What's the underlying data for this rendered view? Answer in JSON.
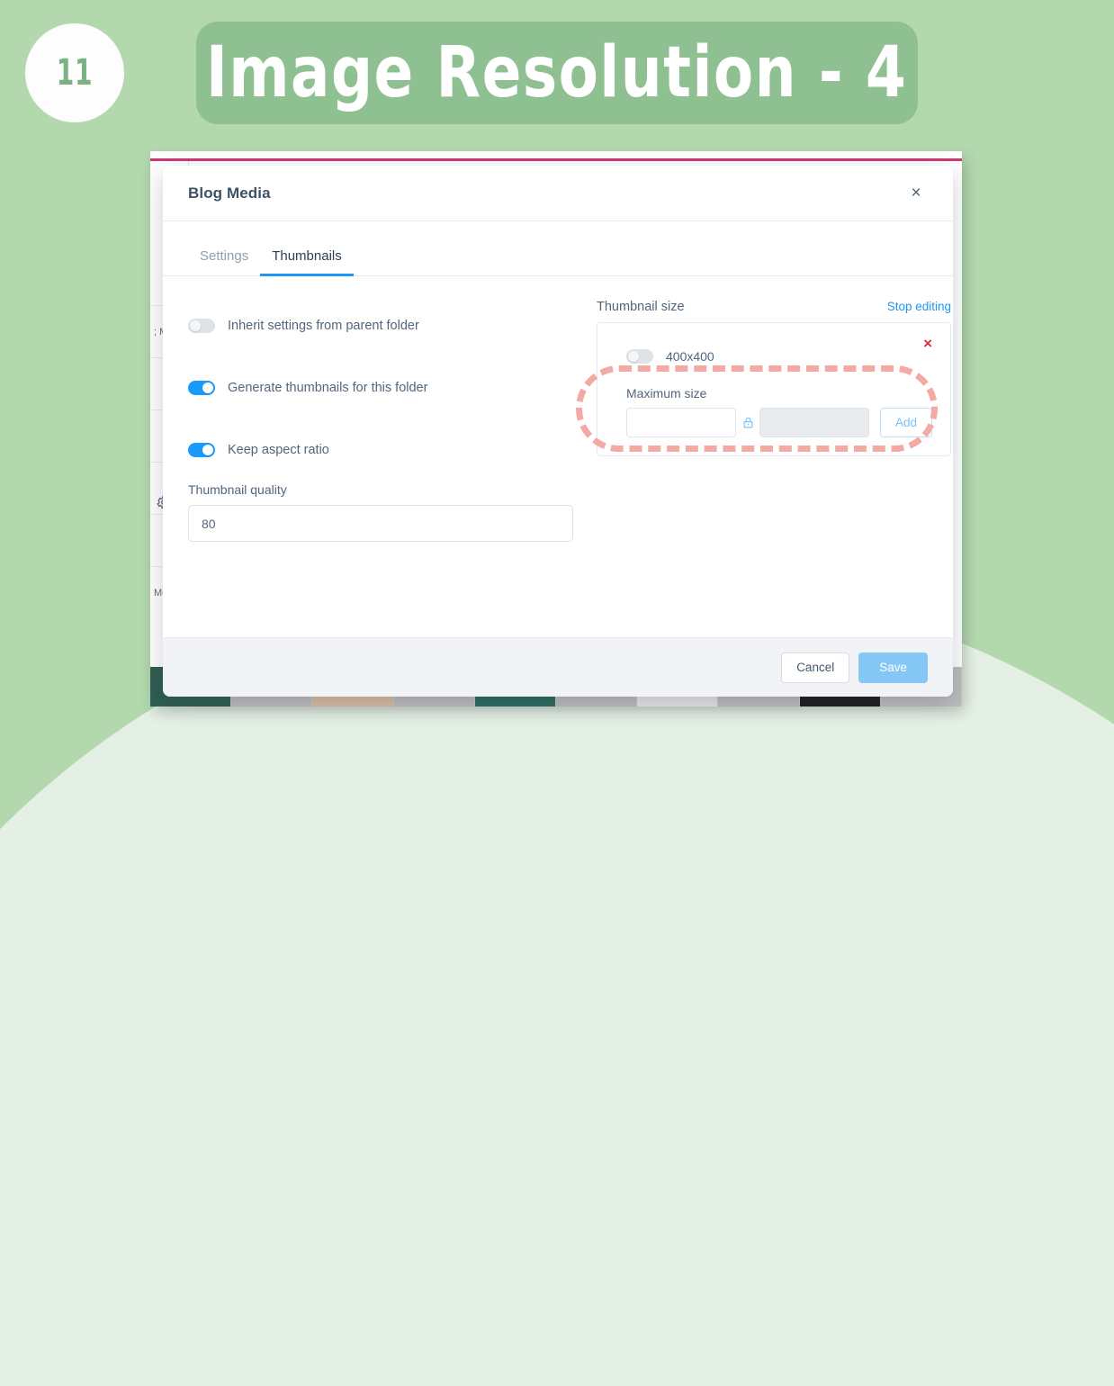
{
  "slide": {
    "number": "11",
    "title": "Image Resolution - 4",
    "accent_green": "#8fc091",
    "background_green": "#b3d8ae",
    "curve_green": "#e4f0e4"
  },
  "background_app": {
    "sidebar_fragments": [
      "; M",
      "Me"
    ],
    "gear_icon": "gear-icon"
  },
  "modal": {
    "title": "Blog Media",
    "close_icon": "close-icon",
    "close_label": "×",
    "tabs": [
      {
        "label": "Settings",
        "active": false
      },
      {
        "label": "Thumbnails",
        "active": true
      }
    ],
    "left": {
      "toggles": [
        {
          "label": "Inherit settings from parent folder",
          "on": false
        },
        {
          "label": "Generate thumbnails for this folder",
          "on": true
        },
        {
          "label": "Keep aspect ratio",
          "on": true
        }
      ],
      "quality": {
        "label": "Thumbnail quality",
        "value": "80",
        "placeholder": ""
      }
    },
    "right": {
      "section_label": "Thumbnail size",
      "stop_editing_label": "Stop editing",
      "delete_icon": "close-icon",
      "delete_label": "×",
      "size_entry": {
        "label": "400x400",
        "on": false
      },
      "max_size_label": "Maximum size",
      "width_input": {
        "value": "",
        "placeholder": ""
      },
      "lock_icon": "lock-closed-icon",
      "height_input": {
        "value": "",
        "placeholder": "",
        "disabled": true
      },
      "add_label": "Add"
    },
    "footer": {
      "cancel_label": "Cancel",
      "save_label": "Save"
    }
  },
  "annotation": {
    "shape": "dashed-ellipse-highlight",
    "color": "#f3a9a4"
  },
  "colors": {
    "toggle_on": "#1a9bfc",
    "tab_active": "#2196f3",
    "link": "#2196f3",
    "delete": "#e8274b",
    "save_button": "#85c8f6"
  }
}
